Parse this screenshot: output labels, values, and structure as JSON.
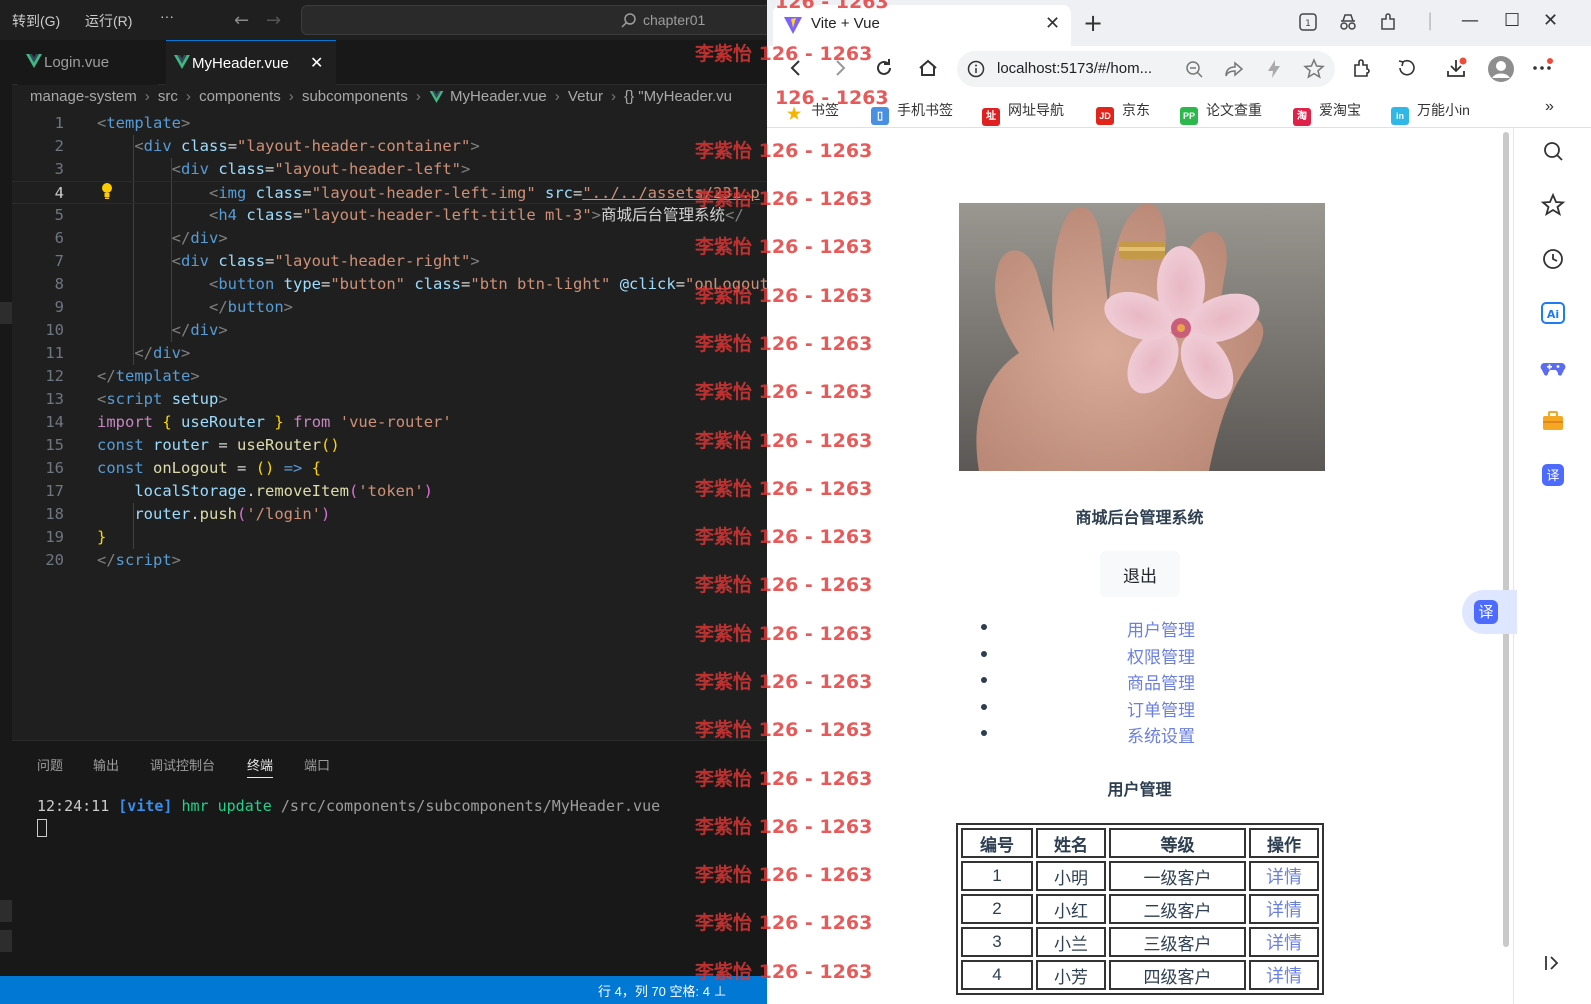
{
  "vscode": {
    "menu": [
      "转到(G)",
      "运行(R)",
      "···"
    ],
    "command_center": "chapter01",
    "tabs": [
      {
        "label": "Login.vue",
        "active": false
      },
      {
        "label": "MyHeader.vue",
        "active": true
      }
    ],
    "breadcrumb": [
      "manage-system",
      "src",
      "components",
      "subcomponents",
      "MyHeader.vue",
      "Vetur",
      "{} \"MyHeader.vu"
    ],
    "line_numbers": [
      "1",
      "2",
      "3",
      "4",
      "5",
      "6",
      "7",
      "8",
      "9",
      "10",
      "11",
      "12",
      "13",
      "14",
      "15",
      "16",
      "17",
      "18",
      "19",
      "20"
    ],
    "code": {
      "l1_tag": "template",
      "l2_tag": "div",
      "l2_attr": "class",
      "l2_val": "\"layout-header-container\"",
      "l3_tag": "div",
      "l3_attr": "class",
      "l3_val": "\"layout-header-left\"",
      "l4_tag": "img",
      "l4_attr1": "class",
      "l4_val1": "\"layout-header-left-img\"",
      "l4_attr2": "src",
      "l4_val2": "\"../../assets/231.p",
      "l5_tag": "h4",
      "l5_attr": "class",
      "l5_val": "\"layout-header-left-title ml-3\"",
      "l5_text": "商城后台管理系统",
      "l6_tag": "div",
      "l7_tag": "div",
      "l7_attr": "class",
      "l7_val": "\"layout-header-right\"",
      "l8_tag": "button",
      "l8_attr1": "type",
      "l8_val1": "\"button\"",
      "l8_attr2": "class",
      "l8_val2": "\"btn btn-light\"",
      "l8_attr3": "@click",
      "l8_val3": "\"onLogout",
      "l9_tag": "button",
      "l10_tag": "div",
      "l11_tag": "div",
      "l12_tag": "template",
      "l13_tag": "script",
      "l13_attr": "setup",
      "l14_kw": "import",
      "l14_name": "useRouter",
      "l14_from": "from",
      "l14_str": "'vue-router'",
      "l15_kw": "const",
      "l15_var": "router",
      "l15_fn": "useRouter",
      "l16_kw": "const",
      "l16_fn": "onLogout",
      "l17_obj": "localStorage",
      "l17_fn": "removeItem",
      "l17_str": "'token'",
      "l18_obj": "router",
      "l18_fn": "push",
      "l18_str": "'/login'",
      "l20_tag": "script"
    },
    "panel_tabs": [
      "问题",
      "输出",
      "调试控制台",
      "终端",
      "端口"
    ],
    "active_panel_tab": "终端",
    "terminal": {
      "time": "12:24:11",
      "tag": "[vite]",
      "action": "hmr update",
      "path": "/src/components/subcomponents/MyHeader.vue"
    },
    "status": "行 4，列 70    空格: 4    ⊥"
  },
  "browser": {
    "tab_title": "Vite + Vue",
    "url": "localhost:5173/#/hom...",
    "bookmarks": [
      {
        "label": "书签",
        "icon": "star-icon",
        "color": "#f4b400"
      },
      {
        "label": "手机书签",
        "icon": "phone-icon",
        "color": "#4a90e2"
      },
      {
        "label": "网址导航",
        "icon": "nav-icon",
        "color": "#e02020"
      },
      {
        "label": "京东",
        "icon": "jd-icon",
        "color": "#e1251b"
      },
      {
        "label": "论文查重",
        "icon": "pp-icon",
        "color": "#2db84c"
      },
      {
        "label": "爱淘宝",
        "icon": "taobao-icon",
        "color": "#e0224a"
      },
      {
        "label": "万能小in",
        "icon": "in-icon",
        "color": "#2fb7e6"
      }
    ],
    "bookmark_glyphs": [
      "★",
      "▯",
      "址",
      "JD",
      "PP",
      "淘",
      "in"
    ],
    "more_bookmarks": "»"
  },
  "page": {
    "header_title": "商城后台管理系统",
    "logout_label": "退出",
    "nav_items": [
      "用户管理",
      "权限管理",
      "商品管理",
      "订单管理",
      "系统设置"
    ],
    "section_title": "用户管理",
    "table_headers": [
      "编号",
      "姓名",
      "等级",
      "操作"
    ],
    "table_rows": [
      [
        "1",
        "小明",
        "一级客户",
        "详情"
      ],
      [
        "2",
        "小红",
        "二级客户",
        "详情"
      ],
      [
        "3",
        "小兰",
        "三级客户",
        "详情"
      ],
      [
        "4",
        "小芳",
        "四级客户",
        "详情"
      ]
    ],
    "link_color": "#6b7fe0",
    "translate_label": "译"
  },
  "watermark": {
    "name": "李紫怡",
    "code": "126 - 1263",
    "name_partial": "126 - 1263"
  }
}
